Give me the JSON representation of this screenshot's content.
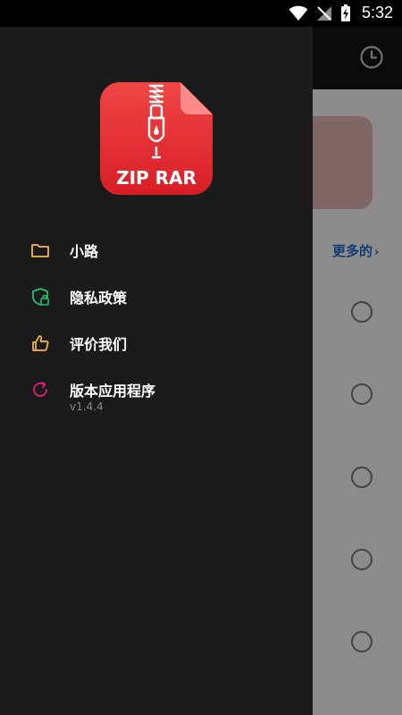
{
  "status_bar": {
    "time": "5:32"
  },
  "drawer": {
    "logo_text": "ZIP RAR",
    "items": [
      {
        "label": "小路",
        "icon": "folder-icon",
        "color": "#f5b942"
      },
      {
        "label": "隐私政策",
        "icon": "shield-lock-icon",
        "color": "#25c06d"
      },
      {
        "label": "评价我们",
        "icon": "thumbs-up-icon",
        "color": "#f5b942"
      },
      {
        "label": "版本应用程序",
        "sub": "v1.4.4",
        "icon": "refresh-icon",
        "color": "#e21f76"
      }
    ]
  },
  "background": {
    "more_label": "更多的",
    "accent": "#1f6fd6"
  }
}
